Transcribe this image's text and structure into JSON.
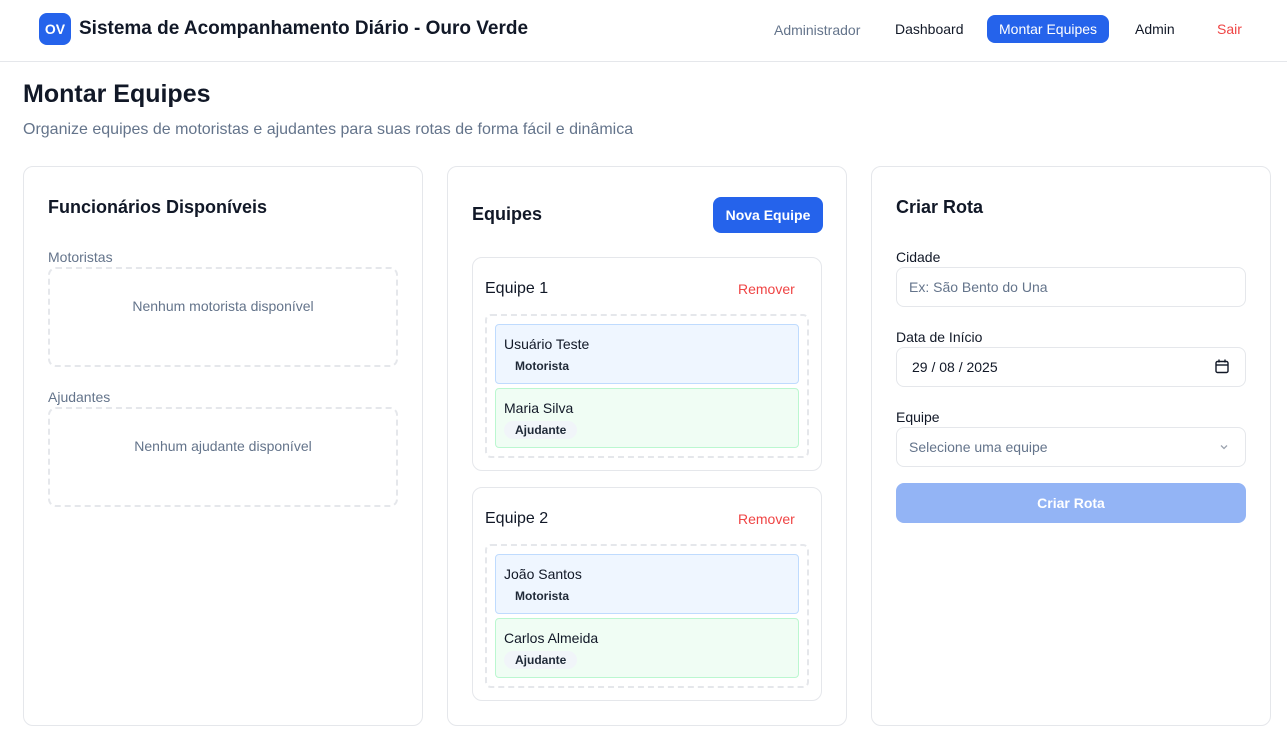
{
  "header": {
    "logo_text": "OV",
    "title": "Sistema de Acompanhamento Diário - Ouro Verde",
    "user_label": "Administrador",
    "nav": [
      {
        "label": "Dashboard",
        "active": false
      },
      {
        "label": "Montar Equipes",
        "active": true
      },
      {
        "label": "Admin",
        "active": false
      },
      {
        "label": "Sair",
        "active": false
      }
    ]
  },
  "page": {
    "title": "Montar Equipes",
    "subtitle": "Organize equipes de motoristas e ajudantes para suas rotas de forma fácil e dinâmica"
  },
  "available": {
    "title": "Funcionários Disponíveis",
    "drivers_label": "Motoristas",
    "drivers_empty": "Nenhum motorista disponível",
    "helpers_label": "Ajudantes",
    "helpers_empty": "Nenhum ajudante disponível"
  },
  "teams": {
    "title": "Equipes",
    "new_button": "Nova Equipe",
    "remove_label": "Remover",
    "items": [
      {
        "name": "Equipe 1",
        "members": [
          {
            "name": "Usuário Teste",
            "role": "Motorista"
          },
          {
            "name": "Maria Silva",
            "role": "Ajudante"
          }
        ]
      },
      {
        "name": "Equipe 2",
        "members": [
          {
            "name": "João Santos",
            "role": "Motorista"
          },
          {
            "name": "Carlos Almeida",
            "role": "Ajudante"
          }
        ]
      }
    ]
  },
  "route": {
    "title": "Criar Rota",
    "city_label": "Cidade",
    "city_placeholder": "Ex: São Bento do Una",
    "city_value": "",
    "date_label": "Data de Início",
    "date_value": "29 / 08 / 2025",
    "team_label": "Equipe",
    "team_placeholder": "Selecione uma equipe",
    "submit_label": "Criar Rota",
    "submit_enabled": false
  },
  "colors": {
    "primary": "#2563eb",
    "danger": "#ef4444",
    "muted": "#64748b",
    "driver_bg": "#eff6ff",
    "helper_bg": "#f0fdf4",
    "disabled_button": "#93b4f5"
  },
  "icons": [
    "calendar-icon",
    "chevron-down-icon"
  ]
}
